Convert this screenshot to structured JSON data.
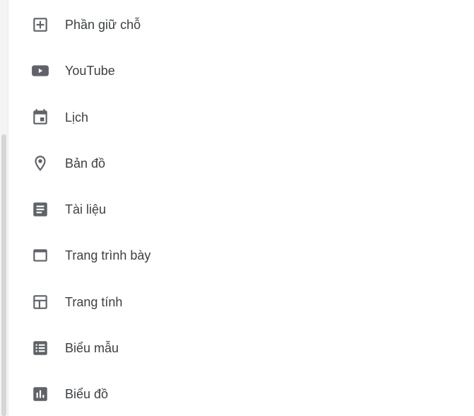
{
  "menu": {
    "items": [
      {
        "icon": "add-box-icon",
        "label": "Phần giữ chỗ"
      },
      {
        "icon": "youtube-icon",
        "label": "YouTube"
      },
      {
        "icon": "calendar-icon",
        "label": "Lịch"
      },
      {
        "icon": "map-pin-icon",
        "label": "Bản đồ"
      },
      {
        "icon": "docs-icon",
        "label": "Tài liệu"
      },
      {
        "icon": "slides-icon",
        "label": "Trang trình bày"
      },
      {
        "icon": "sheets-icon",
        "label": "Trang tính"
      },
      {
        "icon": "forms-icon",
        "label": "Biểu mẫu"
      },
      {
        "icon": "chart-icon",
        "label": "Biểu đồ"
      }
    ]
  },
  "colors": {
    "icon": "#5f6368",
    "text": "#3c4043",
    "background": "#ffffff"
  }
}
